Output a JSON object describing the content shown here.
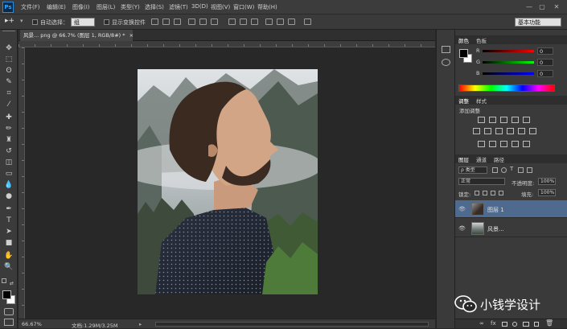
{
  "app": {
    "logo": "Ps"
  },
  "menu": [
    "文件(F)",
    "编辑(E)",
    "图像(I)",
    "图层(L)",
    "类型(Y)",
    "选择(S)",
    "滤镜(T)",
    "3D(D)",
    "视图(V)",
    "窗口(W)",
    "帮助(H)"
  ],
  "window_buttons": [
    "—",
    "▢",
    "✕"
  ],
  "options": {
    "auto_select_label": "自动选择：",
    "auto_select_value": "组",
    "show_transform_label": "显示变换控件",
    "workspace": "基本功能"
  },
  "document": {
    "tab_title": "风景... png @ 66.7% (图层 1, RGB/8#) *",
    "tab_close": "×"
  },
  "status": {
    "zoom": "66.67%",
    "doc_info": "文档:1.29M/3.25M"
  },
  "color_panel": {
    "tabs": [
      "颜色",
      "色板"
    ],
    "channels": [
      {
        "label": "R",
        "value": "0"
      },
      {
        "label": "G",
        "value": "0"
      },
      {
        "label": "B",
        "value": "0"
      }
    ]
  },
  "adjust_panel": {
    "tabs": [
      "调整",
      "样式"
    ],
    "add_label": "添加调整"
  },
  "layers_panel": {
    "tabs": [
      "图层",
      "通道",
      "路径"
    ],
    "filter_label": "ρ 类型",
    "blend_mode": "正常",
    "opacity_label": "不透明度:",
    "opacity_value": "100%",
    "lock_label": "锁定:",
    "fill_label": "填充:",
    "fill_value": "100%",
    "layers": [
      {
        "name": "图层 1",
        "selected": true
      },
      {
        "name": "风景...",
        "selected": false
      }
    ],
    "footer_icons": [
      "link-icon",
      "fx-icon",
      "mask-icon",
      "adjustment-icon",
      "folder-icon",
      "new-layer-icon",
      "trash-icon"
    ]
  },
  "watermark": {
    "text": "小钱学设计"
  },
  "colors": {
    "accent": "#31a8ff",
    "selected_layer": "#4f6a8f",
    "panel": "#3a3a3a"
  }
}
